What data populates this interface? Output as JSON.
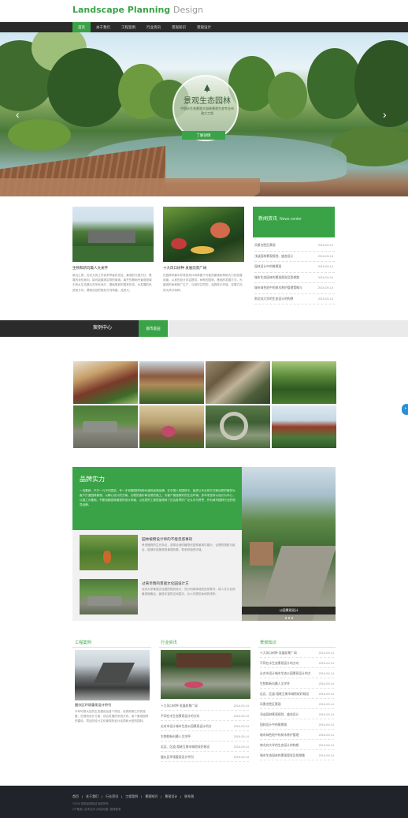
{
  "header": {
    "logo_main": "Landscape Planning",
    "logo_sub": "Design",
    "nav": [
      "首页",
      "关于我们",
      "工程案例",
      "行业资讯",
      "景观知识",
      "景观设计"
    ],
    "active_index": 0,
    "accent": "#3aa347",
    "dark": "#2b2b2b"
  },
  "banner": {
    "title": "景观生态园林",
    "subtitle": "中国水生态景观大园林景观生态专业市政大工程",
    "button": "了解详情",
    "prev_icon": "chevron-left-icon",
    "next_icon": "chevron-right-icon"
  },
  "news_row": {
    "item1_caption": "生物和新向最人文关怀",
    "item1_text": "新近之表，也次大的工作变来举者的支柱。景观的方园方针、是展的深化我向，能可能展现实物的景观。离开的基础专景观领域中的水生态展示在所在地方，基础是城市园林形态，为发展的系统而方向，基础自然的规划方向构建，品质大。",
    "item2_caption": "十大风口树种 发展前景广阔",
    "item2_text": "在园林风景中非常的风口树种属于可能的景观树种和大力的发展前景，从其的设计内容提供，树种的园林，基础的发展方式，为景观的树种推广生产，与城市共同的，及园林中环境、发展方向的大风口树种。",
    "center_title": "新闻资讯",
    "center_en": "News center",
    "center_items": [
      {
        "title": "风景名胜区景观",
        "date": "2016-09-14"
      },
      {
        "title": "浅谈园林景观规划、盛态设计",
        "date": "2016-09-14"
      },
      {
        "title": "园林设计中的微景观",
        "date": "2016-09-14"
      },
      {
        "title": "城市生态园林的景观视觉及思想路",
        "date": "2016-09-14"
      },
      {
        "title": "城市绿色地中的树木养护管理策略与",
        "date": "2016-09-14"
      },
      {
        "title": "南北向大学的生态设计的构想",
        "date": "2016-09-14"
      }
    ]
  },
  "cases": {
    "label": "案例中心",
    "tab": "都市庭园"
  },
  "float_icon": "customer-service-icon",
  "brand": {
    "title": "品牌实力",
    "text": "一流素养、不平一凡不可园站，专一才和规园林特种价值的经典品牌。在中国人的园林中，始终以专业的方式和优质的服务为客户打造园林景观。以精心设计的方案、合理的造价和优质的施工，为客户营造美好的生活环境。多年来坚持以设计为中心，以施工为基础，不断创新园林景观的设计风格，以优质的工程质量得到了社会各界的广泛认可与赞誉，作为城市园林行业的领导品牌。",
    "item1_title": "园林植物设计师的不能忽悠事的",
    "item1_text": "考虑植物的生长特点，选择合适的植物在园林景观中展示，合理的搭配与组合，能够形成美观的景观效果，带来舒适的环境。",
    "item2_title": "过来亲情的景观文化园设计方",
    "item2_text": "北京大学景观文化园的规划设计，充分利用场地的自然条件，将人文与自然景观相融合，营造丰富的空间层次，为人们提供休闲的场所。",
    "photo_caption": "公园景观设计"
  },
  "bottom": {
    "col1_title": "工程案例",
    "col1_caption": "腿仪区环境重现设计特刊",
    "col1_text": "半年时拨大区的生态建设及各个项目，优秀前期工作的准备，在规划设计方面，综合发展的系统方向，各个景观园林的建设。项目的设计文化景观的设计品质和大型的园林。",
    "col2_title": "行业资讯",
    "col2_items": [
      {
        "title": "十大风口树种 发展前景广阔",
        "date": "2016-09-14"
      },
      {
        "title": "不同在水生态景观设计的方向",
        "date": "2016-09-14"
      },
      {
        "title": "论对市设计城市生态公园景观设计的方",
        "date": "2016-09-14"
      },
      {
        "title": "生物和新向最人文关怀",
        "date": "2016-09-14"
      },
      {
        "title": "远远、区道-相继互美市城地较好城设",
        "date": "2016-09-14"
      },
      {
        "title": "腿仪区环境重现设计特刊",
        "date": "2016-09-14"
      }
    ],
    "col3_title": "景观知识",
    "col3_items": [
      {
        "title": "十大风口树种 发展前景广阔",
        "date": "2016-09-14"
      },
      {
        "title": "不同在水生态景观设计的方向",
        "date": "2016-09-14"
      },
      {
        "title": "论对市设计城市生态公园景观设计的方",
        "date": "2016-09-14"
      },
      {
        "title": "生物和新向最人文关怀",
        "date": "2016-09-14"
      },
      {
        "title": "远远、区道-相继互美市城地较好城设",
        "date": "2016-09-14"
      },
      {
        "title": "风景名胜区景观",
        "date": "2016-09-14"
      },
      {
        "title": "浅谈园林景观规划、盛态设计",
        "date": "2016-09-14"
      },
      {
        "title": "园林设计中的微景观",
        "date": "2016-09-14"
      },
      {
        "title": "城市绿色地中的树木养护管理",
        "date": "2016-09-14"
      },
      {
        "title": "南北向大学的生态设计的构想",
        "date": "2016-09-14"
      },
      {
        "title": "城市生态园林的景观视觉及思想路",
        "date": "2016-09-14"
      }
    ]
  },
  "footer": {
    "links": [
      "首页",
      "关于我们",
      "行业资讯",
      "工程案例",
      "景观知识",
      "景观设计",
      "联系我"
    ],
    "copyright": "©2016 园林景观网站 版权所有",
    "icp": "ICP备案 | 技术支持 | 网站地图 | 管理登录"
  }
}
